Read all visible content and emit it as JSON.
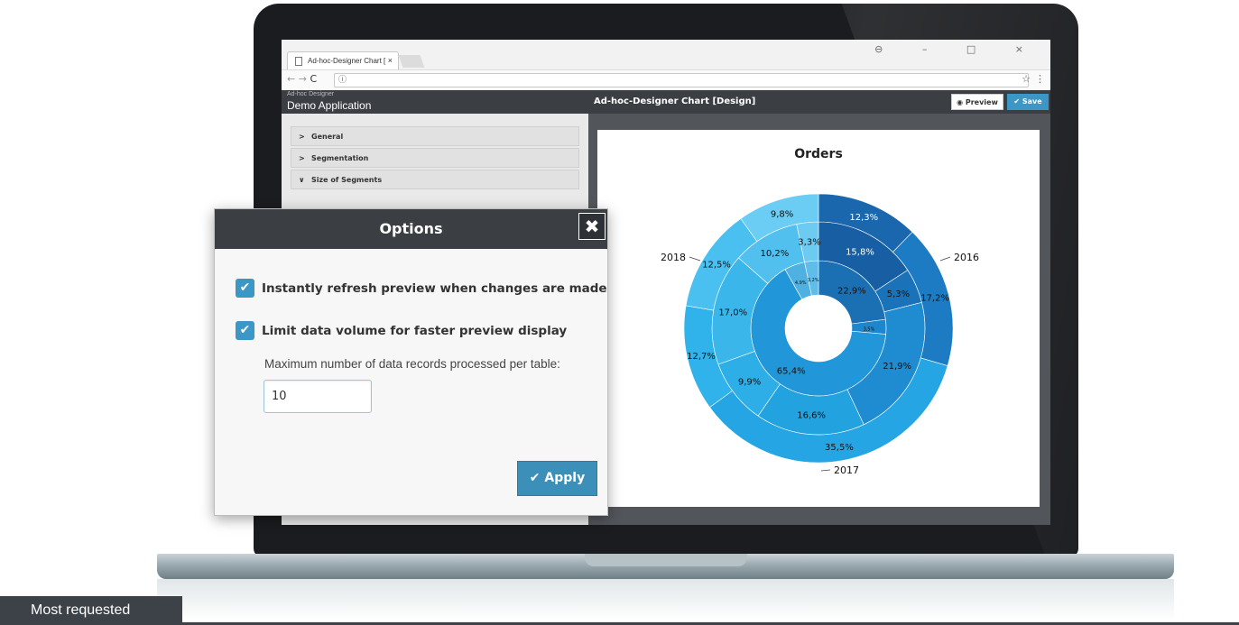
{
  "browser": {
    "tab_title": "Ad-hoc-Designer Chart [",
    "tab_close": "×",
    "url": "ⓘ",
    "nav": [
      "←",
      "→",
      "C"
    ],
    "star": "☆",
    "menu": "⋮",
    "window_controls": "⊖ – □ ×"
  },
  "app": {
    "subtitle": "Ad-hoc Designer",
    "name": "Demo Application",
    "title": "Ad-hoc-Designer Chart [Design]",
    "preview_label": "Preview",
    "save_label": "Save"
  },
  "sidebar": {
    "items": [
      {
        "chevron": ">",
        "label": "General"
      },
      {
        "chevron": ">",
        "label": "Segmentation"
      },
      {
        "chevron": "∨",
        "label": "Size of Segments"
      }
    ]
  },
  "dialog": {
    "title": "Options",
    "close": "✖",
    "option1_label": "Instantly refresh preview when changes are made",
    "option1_checked": true,
    "option2_label": "Limit data volume for faster preview display",
    "option2_checked": true,
    "max_records_label": "Maximum number of data records processed per table:",
    "max_records_value": "10",
    "apply_label": "Apply"
  },
  "badge": "Most requested",
  "colors": {
    "accent": "#3a97c6",
    "header": "#3b3e43"
  },
  "chart_data": {
    "type": "sunburst",
    "title": "Orders",
    "rings": {
      "inner": [
        {
          "label": "22,9%",
          "value": 22.9,
          "color": "#1b70b3"
        },
        {
          "label": "3,5%",
          "value": 3.5,
          "color": "#1e86cc"
        },
        {
          "label": "65,4%",
          "value": 65.4,
          "color": "#2196d8"
        },
        {
          "label": "4,9%",
          "value": 4.9,
          "color": "#4fb0e2"
        },
        {
          "label": "3,2%",
          "value": 3.3,
          "color": "#5ebde9"
        }
      ],
      "middle": [
        {
          "label": "15,8%",
          "value": 15.8,
          "color": "#175fa2"
        },
        {
          "label": "5,3%",
          "value": 5.3,
          "color": "#1a73b8"
        },
        {
          "label": "21,9%",
          "value": 21.9,
          "color": "#1f8bd1"
        },
        {
          "label": "16,6%",
          "value": 16.6,
          "color": "#23a2e0"
        },
        {
          "label": "9,9%",
          "value": 9.9,
          "color": "#2eaee6"
        },
        {
          "label": "17,0%",
          "value": 17.0,
          "color": "#3ab6ea"
        },
        {
          "label": "10,2%",
          "value": 10.2,
          "color": "#52c0ee"
        },
        {
          "label": "3,3%",
          "value": 3.3,
          "color": "#6dcbf2"
        }
      ],
      "outer": [
        {
          "label": "12,3%",
          "value": 12.3,
          "color": "#1a67ad"
        },
        {
          "label": "17,2%",
          "value": 17.2,
          "color": "#1c7bc2"
        },
        {
          "label": "35,5%",
          "value": 35.5,
          "color": "#25a5e3"
        },
        {
          "label": "12,7%",
          "value": 12.7,
          "color": "#2fb3ea"
        },
        {
          "label": "12,5%",
          "value": 12.5,
          "color": "#49c0f0"
        },
        {
          "label": "9,8%",
          "value": 9.8,
          "color": "#6bcdf4"
        }
      ]
    },
    "year_labels": [
      "2016",
      "2017",
      "2018"
    ]
  }
}
